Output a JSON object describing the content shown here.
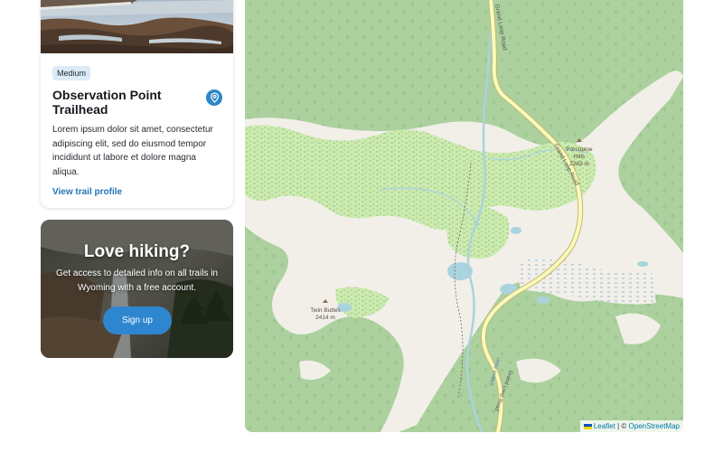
{
  "trail_card": {
    "difficulty": "Medium",
    "title": "Observation Point Trailhead",
    "description": "Lorem ipsum dolor sit amet, consectetur adipiscing elit, sed do eiusmod tempor incididunt ut labore et dolore magna aliqua.",
    "link_label": "View trail profile"
  },
  "promo": {
    "title": "Love hiking?",
    "text": "Get access to detailed info on all trails in Wyoming with a free account.",
    "button_label": "Sign up"
  },
  "map": {
    "labels": {
      "road_north": "Grand Loop Road",
      "road_east": "Grand Loop Road",
      "road_south": "Grand Loop Road",
      "river": "Gibbon River",
      "peak_east_name": "Porcupine Hills",
      "peak_east_line1": "Porcupine",
      "peak_east_line2": "Hills",
      "peak_east_elev": "2283 m",
      "peak_west_name": "Twin Buttes",
      "peak_west_elev": "2414 m"
    },
    "attribution": {
      "leaflet": "Leaflet",
      "separator": "| ©",
      "osm": "OpenStreetMap"
    },
    "colors": {
      "forest": "#acd09e",
      "clearing": "#f2efe9",
      "meadow": "#cdebb0",
      "road_fill": "#f7fabf",
      "road_casing": "#c6b86a",
      "water": "#aad3df"
    }
  },
  "colors": {
    "accent": "#2f86d0",
    "link": "#2175b8",
    "badge_bg": "#dcebf7"
  }
}
